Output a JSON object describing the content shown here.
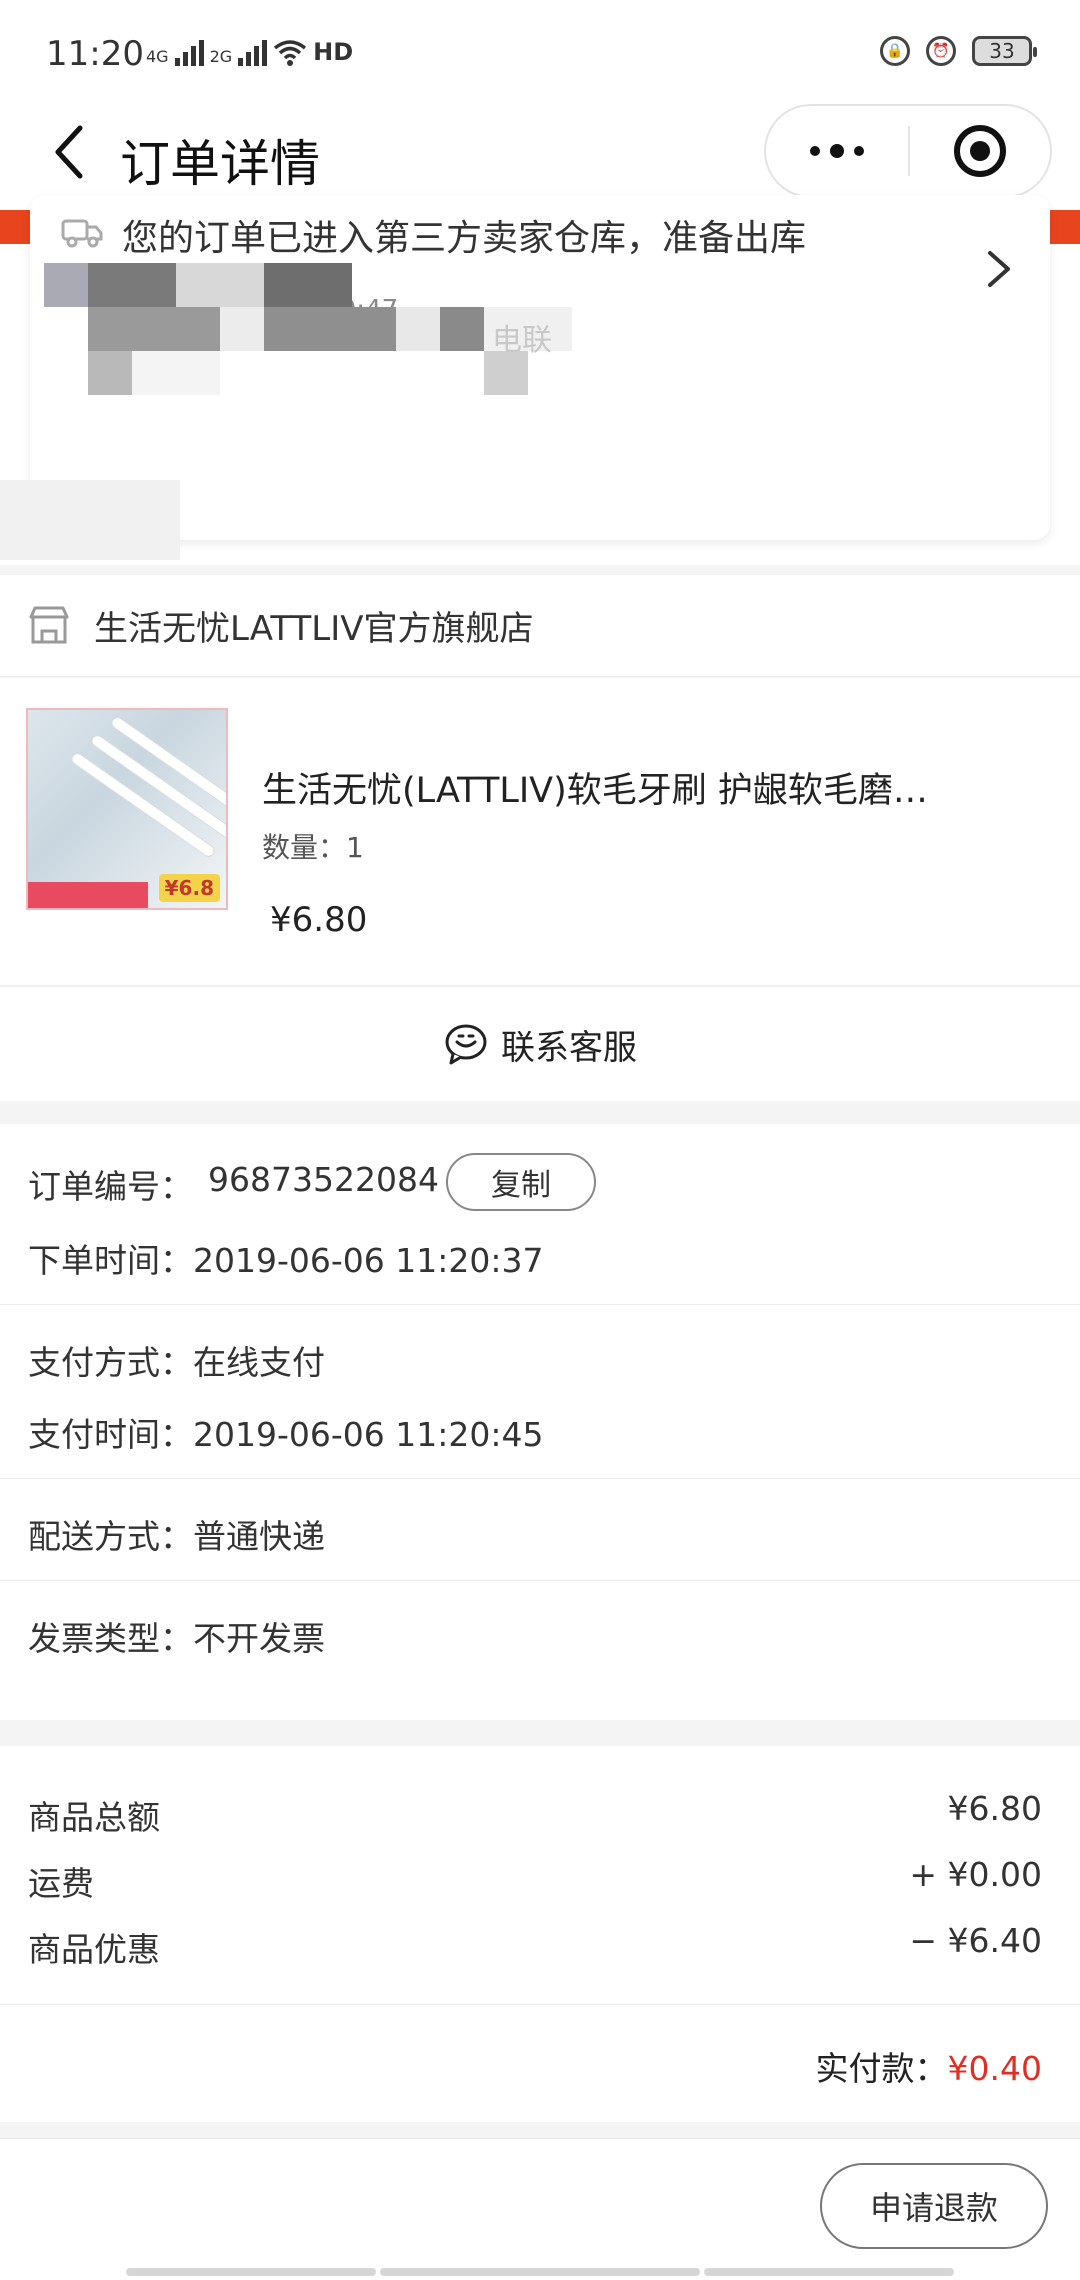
{
  "status_bar": {
    "time": "11:20",
    "net1": "4G",
    "net2": "2G",
    "wifi_badge": "HD",
    "battery": "33"
  },
  "nav": {
    "title": "订单详情"
  },
  "order_status": {
    "message": "您的订单已进入第三方卖家仓库，准备出库",
    "time": "2019-06-06 11:20:47",
    "contact_blurred": "电联"
  },
  "store": {
    "name": "生活无忧LATTLIV官方旗舰店"
  },
  "product": {
    "title": "生活无忧(LATTLIV)软毛牙刷 护龈软毛磨…",
    "quantity": "数量：1",
    "price": "¥6.80",
    "thumb_tag": "¥6.8"
  },
  "contact": {
    "label": "联系客服"
  },
  "order_info": {
    "order_no_label": "订单编号：",
    "order_no": "96873522084",
    "copy_label": "复制",
    "order_time": "下单时间：2019-06-06 11:20:37",
    "pay_method": "支付方式：在线支付",
    "pay_time": "支付时间：2019-06-06 11:20:45",
    "delivery": "配送方式：普通快递",
    "invoice": "发票类型：不开发票"
  },
  "totals": {
    "goods_label": "商品总额",
    "goods_value": "¥6.80",
    "shipping_label": "运费",
    "shipping_value": "+ ¥0.00",
    "discount_label": "商品优惠",
    "discount_value": "− ¥6.40",
    "paid_label": "实付款：",
    "paid_value": "¥0.40"
  },
  "actions": {
    "refund_label": "申请退款"
  },
  "colors": {
    "accent_red": "#e02e24",
    "orange_band": "#e8441e"
  }
}
